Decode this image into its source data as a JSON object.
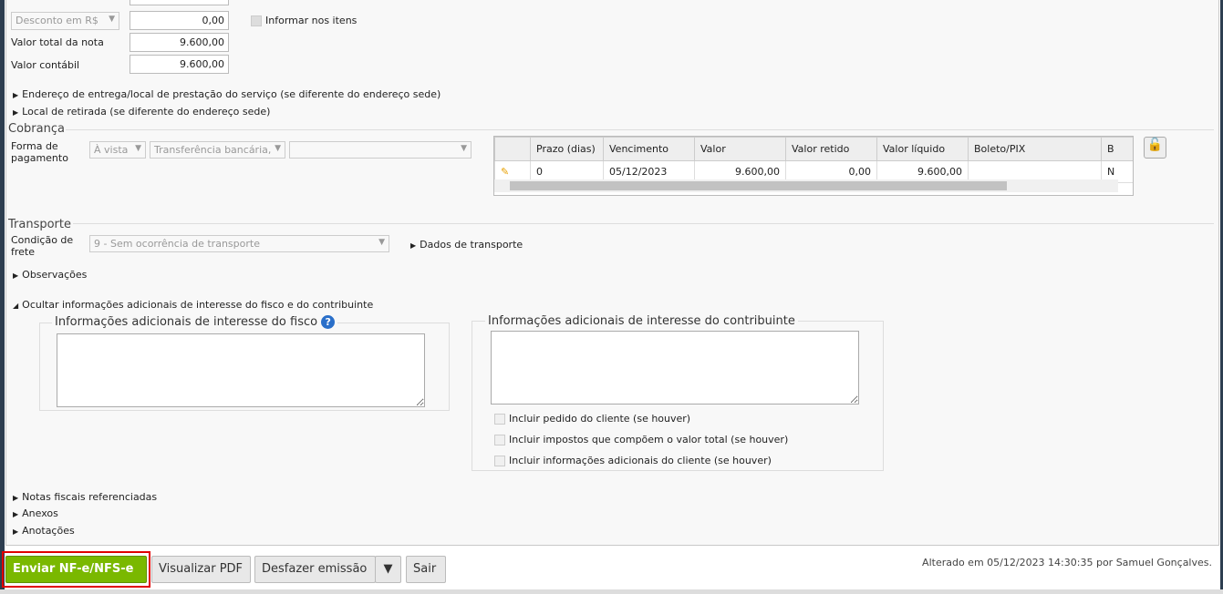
{
  "totals": {
    "discount_type": "Desconto em R$",
    "discount_value": "0,00",
    "inform_items_label": "Informar nos itens",
    "total_label": "Valor total da nota",
    "total_value": "9.600,00",
    "accounting_label": "Valor contábil",
    "accounting_value": "9.600,00"
  },
  "sections": {
    "delivery": "Endereço de entrega/local de prestação do serviço (se diferente do endereço sede)",
    "pickup": "Local de retirada (se diferente do endereço sede)"
  },
  "billing": {
    "title": "Cobrança",
    "payment_label_1": "Forma de",
    "payment_label_2": "pagamento",
    "term": "À vista",
    "method": "Transferência bancária,",
    "extra": "",
    "columns": [
      "Prazo (dias)",
      "Vencimento",
      "Valor",
      "Valor retido",
      "Valor líquido",
      "Boleto/PIX",
      "B"
    ],
    "rows": [
      {
        "prazo": "0",
        "vencimento": "05/12/2023",
        "valor": "9.600,00",
        "retido": "0,00",
        "liquido": "9.600,00",
        "boleto": "",
        "b": "N"
      }
    ]
  },
  "transport": {
    "title": "Transporte",
    "freight_label_1": "Condição de",
    "freight_label_2": "frete",
    "freight_value": "9 - Sem ocorrência de transporte",
    "details_link": "Dados de transporte"
  },
  "observations": "Observações",
  "additional": {
    "toggle": "Ocultar informações adicionais de interesse do fisco e do contribuinte",
    "fisco_title": "Informações adicionais de interesse do fisco",
    "contrib_title": "Informações adicionais de interesse do contribuinte",
    "fisco_text": "",
    "contrib_text": "",
    "checks": [
      "Incluir pedido do cliente (se houver)",
      "Incluir impostos que compõem o valor total (se houver)",
      "Incluir informações adicionais do cliente (se houver)"
    ]
  },
  "bottom_sections": [
    "Notas fiscais referenciadas",
    "Anexos",
    "Anotações"
  ],
  "footer": {
    "send": "Enviar NF-e/NFS-e",
    "pdf": "Visualizar PDF",
    "undo": "Desfazer emissão",
    "exit": "Sair",
    "status": "Alterado em 05/12/2023 14:30:35 por Samuel Gonçalves."
  },
  "colors": {
    "send_button": "#7ab800",
    "highlight": "#e00000"
  }
}
